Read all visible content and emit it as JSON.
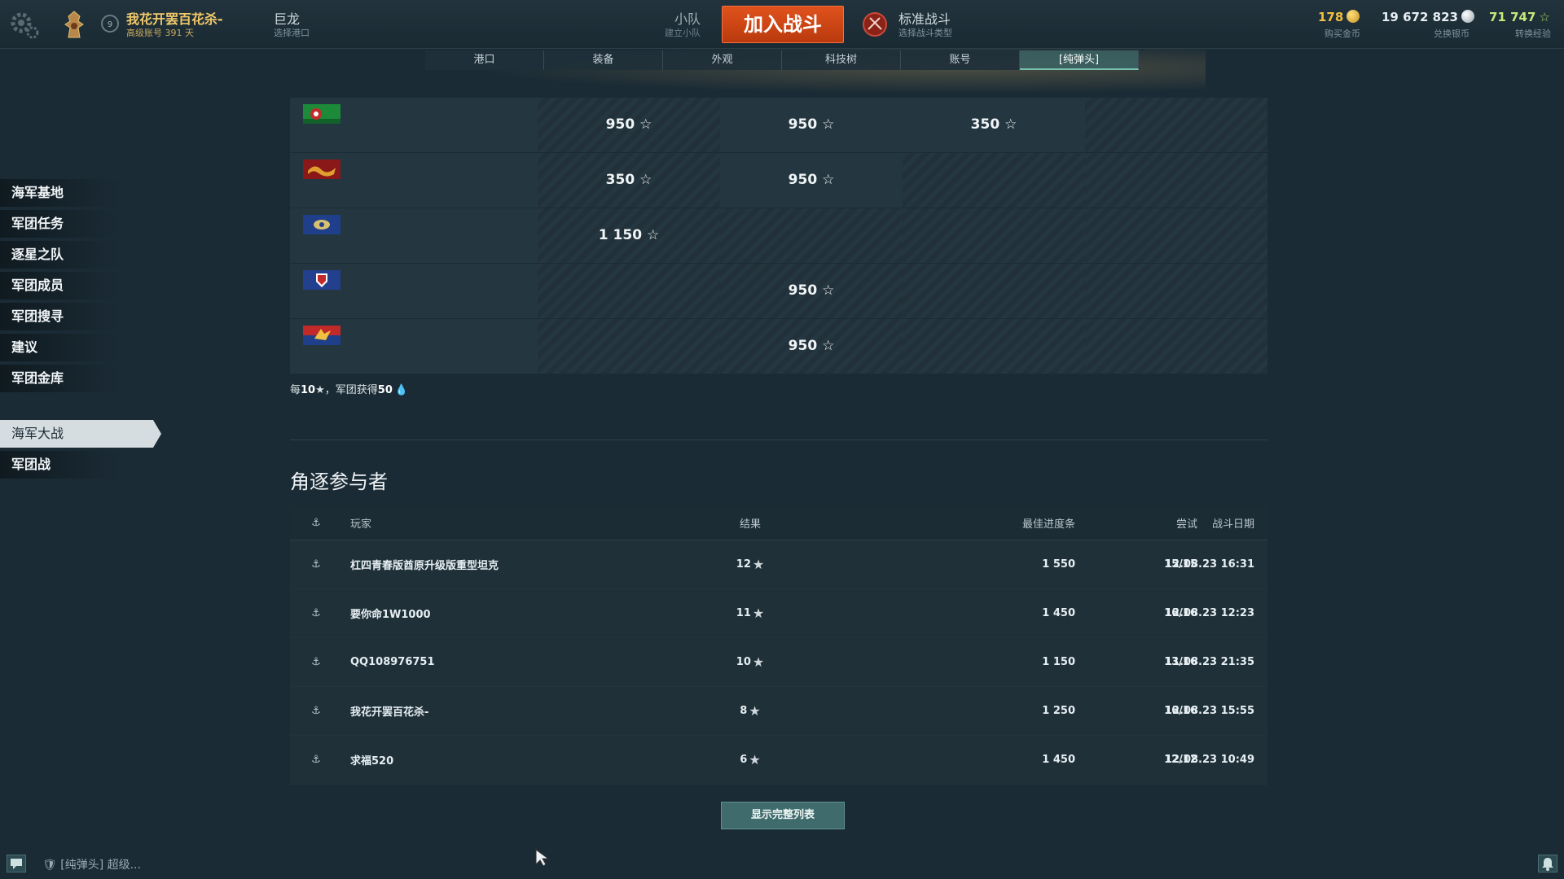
{
  "topbar": {
    "account_name": "我花开罢百花杀-",
    "account_type": "高级账号",
    "account_days": "391 天",
    "level": "9",
    "ship_name": "巨龙",
    "ship_sub": "选择港口",
    "squad_label": "小队",
    "squad_sub": "建立小队",
    "battle_button": "加入战斗",
    "mode_label": "标准战斗",
    "mode_sub": "选择战斗类型",
    "gold_value": "178",
    "gold_label": "购买金币",
    "silver_value": "19 672 823",
    "silver_label": "兑换银币",
    "xp_value": "71 747",
    "xp_label": "转换经验"
  },
  "tabs": [
    {
      "label": "港口"
    },
    {
      "label": "装备"
    },
    {
      "label": "外观"
    },
    {
      "label": "科技树"
    },
    {
      "label": "账号"
    },
    {
      "label": "[纯弹头]"
    }
  ],
  "sidebar": {
    "items": [
      {
        "label": "海军基地"
      },
      {
        "label": "军团任务"
      },
      {
        "label": "逐星之队"
      },
      {
        "label": "军团成员"
      },
      {
        "label": "军团搜寻"
      },
      {
        "label": "建议"
      },
      {
        "label": "军团金库"
      }
    ],
    "items2": [
      {
        "label": "海军大战"
      },
      {
        "label": "军团战"
      }
    ]
  },
  "rewards": {
    "rows": [
      {
        "flag": "flag-green-red",
        "c1": "950",
        "c2": "950",
        "c3": "350"
      },
      {
        "flag": "flag-red-dragon",
        "c1": "350",
        "c2": "950",
        "c3": ""
      },
      {
        "flag": "flag-blue-wings",
        "c1": "1 150",
        "c2": "",
        "c3": ""
      },
      {
        "flag": "flag-blue-red-shield",
        "c1": "",
        "c2": "950",
        "c3": ""
      },
      {
        "flag": "flag-red-blue-bird",
        "c1": "",
        "c2": "950",
        "c3": ""
      }
    ],
    "note_prefix": "每",
    "note_count": "10",
    "note_mid": "，军团获得",
    "note_reward": "50"
  },
  "participants": {
    "title": "角逐参与者",
    "headers": {
      "player": "玩家",
      "result": "结果",
      "best": "最佳进度条",
      "tries": "尝试",
      "date": "战斗日期"
    },
    "rows": [
      {
        "player": "杠四青春版酋原升级版重型坦克",
        "result": "12",
        "best": "1 550",
        "tries": "15/15",
        "date": "12.08.23 16:31"
      },
      {
        "player": "要你命1W1000",
        "result": "11",
        "best": "1 450",
        "tries": "16/16",
        "date": "12.08.23 12:23"
      },
      {
        "player": "QQ108976751",
        "result": "10",
        "best": "1 150",
        "tries": "13/16",
        "date": "11.08.23 21:35"
      },
      {
        "player": "我花开罢百花杀-",
        "result": "8",
        "best": "1 250",
        "tries": "16/16",
        "date": "12.08.23 15:55"
      },
      {
        "player": "求福520",
        "result": "6",
        "best": "1 450",
        "tries": "12/12",
        "date": "12.08.23 10:49"
      }
    ],
    "show_full_button": "显示完整列表"
  },
  "bottom": {
    "chat_text": "[纯弹头]  超级..."
  },
  "colors": {
    "background": "#1b2b35",
    "battle_button": "#c8441a",
    "gold": "#f0c86a",
    "show_full_button": "#3f6b6d"
  }
}
